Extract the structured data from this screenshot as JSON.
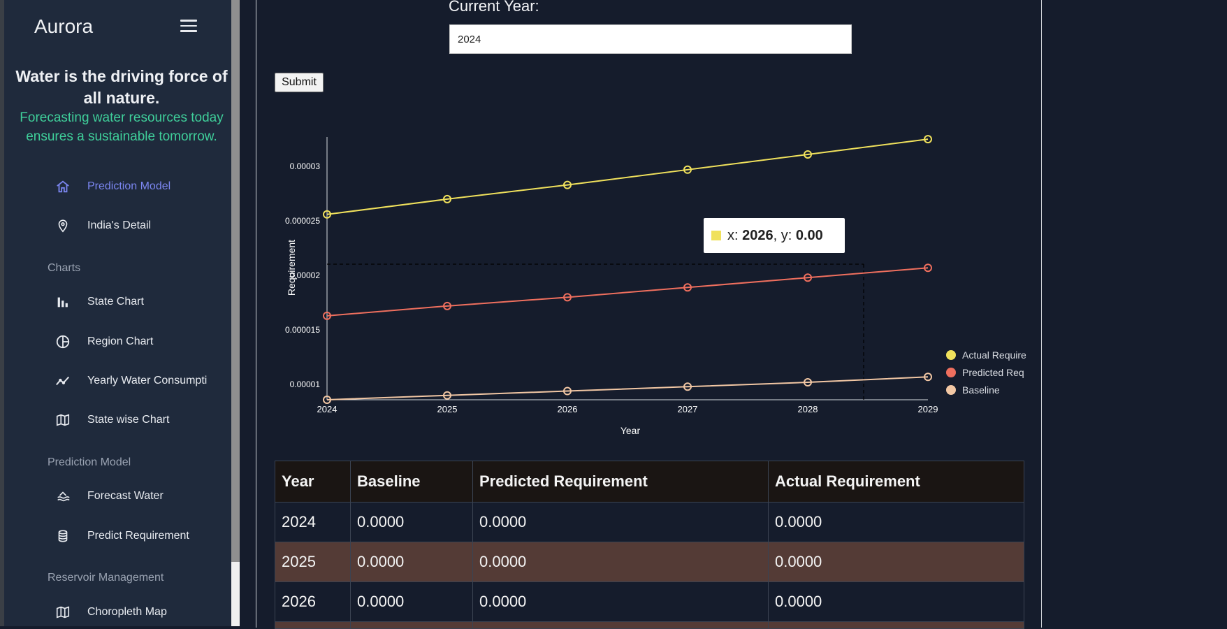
{
  "sidebar": {
    "brand": "Aurora",
    "tagline": "Water is the driving force of all nature.",
    "subtagline": "Forecasting water resources today ensures a sustainable tomorrow.",
    "items": [
      {
        "label": "Prediction Model",
        "icon": "home-icon",
        "active": true
      },
      {
        "label": "India's Detail",
        "icon": "location-pin-icon"
      },
      {
        "label": "State Chart",
        "icon": "bar-chart-icon"
      },
      {
        "label": "Region Chart",
        "icon": "pie-chart-icon"
      },
      {
        "label": "Yearly Water Consumpti",
        "icon": "trend-line-icon"
      },
      {
        "label": "State wise Chart",
        "icon": "map-icon"
      },
      {
        "label": "Forecast Water",
        "icon": "water-waves-icon"
      },
      {
        "label": "Predict Requirement",
        "icon": "database-icon"
      },
      {
        "label": "Choropleth Map",
        "icon": "map-icon"
      }
    ],
    "sections": {
      "charts": "Charts",
      "prediction": "Prediction Model",
      "reservoir": "Reservoir Management"
    }
  },
  "form": {
    "year_label": "Current Year:",
    "year_value": "2024",
    "submit_label": "Submit"
  },
  "tooltip": {
    "x_label": "x: ",
    "x_value": "2026",
    "sep": ", y: ",
    "y_value": "0.00"
  },
  "chart_data": {
    "type": "line",
    "xlabel": "Year",
    "ylabel": "Requirement",
    "x": [
      2024,
      2025,
      2026,
      2027,
      2028,
      2029
    ],
    "ylim": [
      8.6e-06,
      3.27e-05
    ],
    "y_ticks": [
      1e-05,
      1.5e-05,
      2e-05,
      2.5e-05,
      3e-05
    ],
    "y_tick_labels": [
      "0.00001",
      "0.000015",
      "0.00002",
      "0.000025",
      "0.00003"
    ],
    "series": [
      {
        "name": "Actual Requirement",
        "legend_label": "Actual Require",
        "color": "#f0e15c",
        "values": [
          2.56e-05,
          2.7e-05,
          2.83e-05,
          2.97e-05,
          3.11e-05,
          3.25e-05
        ]
      },
      {
        "name": "Predicted Requirement",
        "legend_label": "Predicted Req",
        "color": "#ef6f5e",
        "values": [
          1.63e-05,
          1.72e-05,
          1.8e-05,
          1.89e-05,
          1.98e-05,
          2.07e-05
        ]
      },
      {
        "name": "Baseline",
        "legend_label": "Baseline",
        "color": "#f2c7a4",
        "values": [
          8.6e-06,
          9e-06,
          9.4e-06,
          9.8e-06,
          1.02e-05,
          1.07e-05
        ]
      }
    ],
    "legend_position": "right",
    "grid": false
  },
  "table": {
    "headers": [
      "Year",
      "Baseline",
      "Predicted Requirement",
      "Actual Requirement"
    ],
    "rows": [
      [
        "2024",
        "0.0000",
        "0.0000",
        "0.0000"
      ],
      [
        "2025",
        "0.0000",
        "0.0000",
        "0.0000"
      ],
      [
        "2026",
        "0.0000",
        "0.0000",
        "0.0000"
      ]
    ]
  },
  "colors": {
    "background": "#151c2c",
    "sidebar": "#1f2a3c",
    "accent": "#7b86f0",
    "subtag": "#3fcf9a",
    "row_alt": "#543b36"
  }
}
